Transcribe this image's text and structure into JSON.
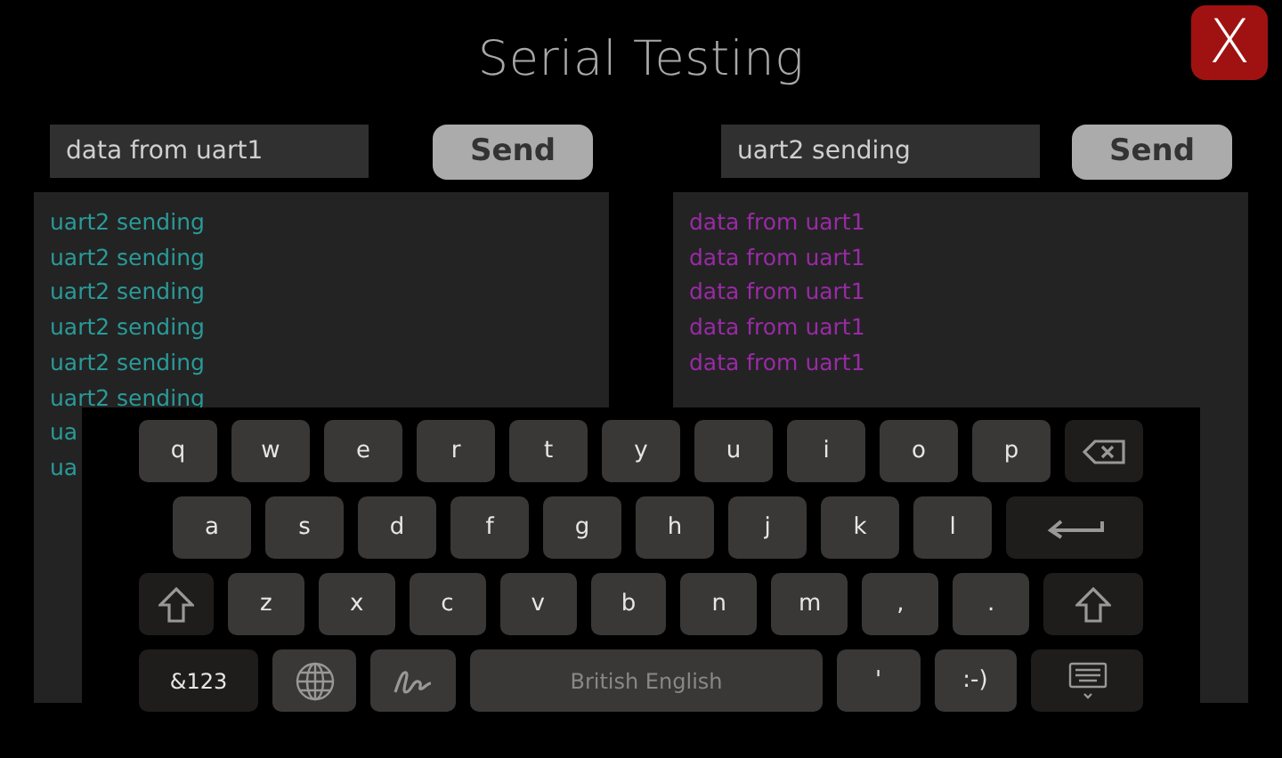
{
  "window": {
    "title": "Serial Testing",
    "close_label": "X"
  },
  "ports": [
    {
      "input_value": "data from uart1",
      "send_label": "Send",
      "color": "#2a9a98",
      "log": [
        "uart2 sending",
        "uart2 sending",
        "uart2 sending",
        "uart2 sending",
        "uart2 sending",
        "uart2 sending",
        "ua",
        "ua"
      ]
    },
    {
      "input_value": "uart2 sending",
      "send_label": "Send",
      "color": "#9a2aa6",
      "log": [
        "data from uart1",
        "data from uart1",
        "data from uart1",
        "data from uart1",
        "data from uart1"
      ]
    }
  ],
  "keyboard": {
    "rows": [
      {
        "keys": [
          {
            "kind": "char",
            "label": "q"
          },
          {
            "kind": "char",
            "label": "w"
          },
          {
            "kind": "char",
            "label": "e"
          },
          {
            "kind": "char",
            "label": "r"
          },
          {
            "kind": "char",
            "label": "t"
          },
          {
            "kind": "char",
            "label": "y"
          },
          {
            "kind": "char",
            "label": "u"
          },
          {
            "kind": "char",
            "label": "i"
          },
          {
            "kind": "char",
            "label": "o"
          },
          {
            "kind": "char",
            "label": "p"
          },
          {
            "kind": "backspace"
          }
        ]
      },
      {
        "keys": [
          {
            "kind": "char",
            "label": "a"
          },
          {
            "kind": "char",
            "label": "s"
          },
          {
            "kind": "char",
            "label": "d"
          },
          {
            "kind": "char",
            "label": "f"
          },
          {
            "kind": "char",
            "label": "g"
          },
          {
            "kind": "char",
            "label": "h"
          },
          {
            "kind": "char",
            "label": "j"
          },
          {
            "kind": "char",
            "label": "k"
          },
          {
            "kind": "char",
            "label": "l"
          },
          {
            "kind": "enter"
          }
        ]
      },
      {
        "keys": [
          {
            "kind": "shift"
          },
          {
            "kind": "char",
            "label": "z"
          },
          {
            "kind": "char",
            "label": "x"
          },
          {
            "kind": "char",
            "label": "c"
          },
          {
            "kind": "char",
            "label": "v"
          },
          {
            "kind": "char",
            "label": "b"
          },
          {
            "kind": "char",
            "label": "n"
          },
          {
            "kind": "char",
            "label": "m"
          },
          {
            "kind": "char",
            "label": ","
          },
          {
            "kind": "char",
            "label": "."
          },
          {
            "kind": "shift"
          }
        ]
      },
      {
        "keys": [
          {
            "kind": "symbols",
            "label": "&123"
          },
          {
            "kind": "globe"
          },
          {
            "kind": "handwriting"
          },
          {
            "kind": "space",
            "label": "British English"
          },
          {
            "kind": "char",
            "label": "'"
          },
          {
            "kind": "char",
            "label": ":-)"
          },
          {
            "kind": "hide"
          }
        ]
      }
    ]
  }
}
